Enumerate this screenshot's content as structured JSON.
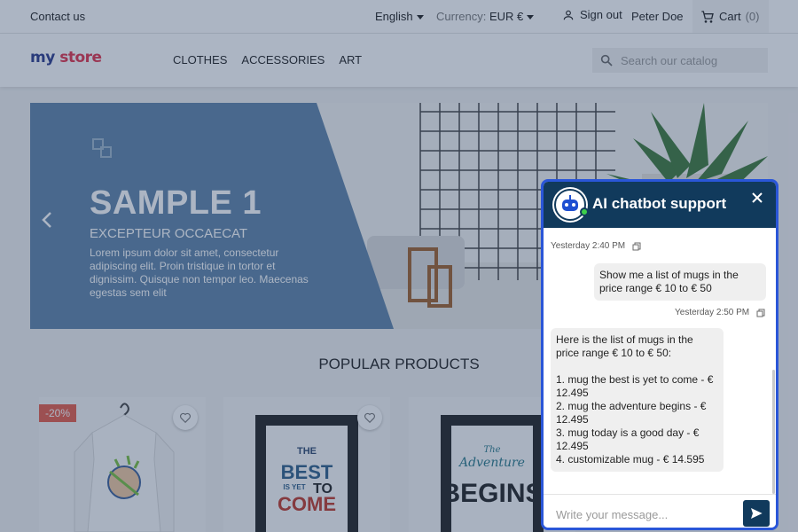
{
  "topbar": {
    "contact": "Contact us",
    "language": "English",
    "currency_label": "Currency:",
    "currency_value": "EUR €",
    "sign_out": "Sign out",
    "user_name": "Peter Doe",
    "cart_label": "Cart",
    "cart_count": "(0)"
  },
  "header": {
    "logo_my": "my",
    "logo_store": "store",
    "nav": [
      "CLOTHES",
      "ACCESSORIES",
      "ART"
    ],
    "search_placeholder": "Search our catalog"
  },
  "hero": {
    "title": "SAMPLE 1",
    "subtitle": "EXCEPTEUR OCCAECAT",
    "text": "Lorem ipsum dolor sit amet, consectetur adipiscing elit. Proin tristique in tortor et dignissim. Quisque non tempor leo. Maecenas egestas sem elit"
  },
  "popular": {
    "heading": "POPULAR PRODUCTS"
  },
  "products": [
    {
      "badge": "-20%"
    },
    {
      "poster_lines": [
        "THE",
        "BEST",
        "IS YET",
        "TO",
        "COME"
      ]
    },
    {
      "poster_lines": [
        "The",
        "Adventure",
        "BEGINS"
      ]
    }
  ],
  "chatbot": {
    "title": "AI chatbot support",
    "messages": [
      {
        "time": "Yesterday 2:40 PM",
        "from": "user",
        "text": "Show me a list of mugs in the price range € 10 to € 50"
      },
      {
        "time": "Yesterday 2:50 PM",
        "from": "bot",
        "intro": "Here is the list of mugs in the price range € 10 to € 50:",
        "items": [
          "1. mug the best is yet to come - € 12.495",
          "2. mug the adventure begins - € 12.495",
          "3. mug today is a good day - € 12.495",
          "4. customizable mug - € 14.595"
        ]
      }
    ],
    "input_placeholder": "Write your message..."
  },
  "colors": {
    "chat_header": "#113a5c",
    "chat_border": "#2a56d8",
    "online_dot": "#3ecf4a",
    "badge": "#e55d49",
    "logo_my": "#2d3a8c",
    "logo_store": "#e2334b",
    "hero_panel": "#5f84a8"
  }
}
